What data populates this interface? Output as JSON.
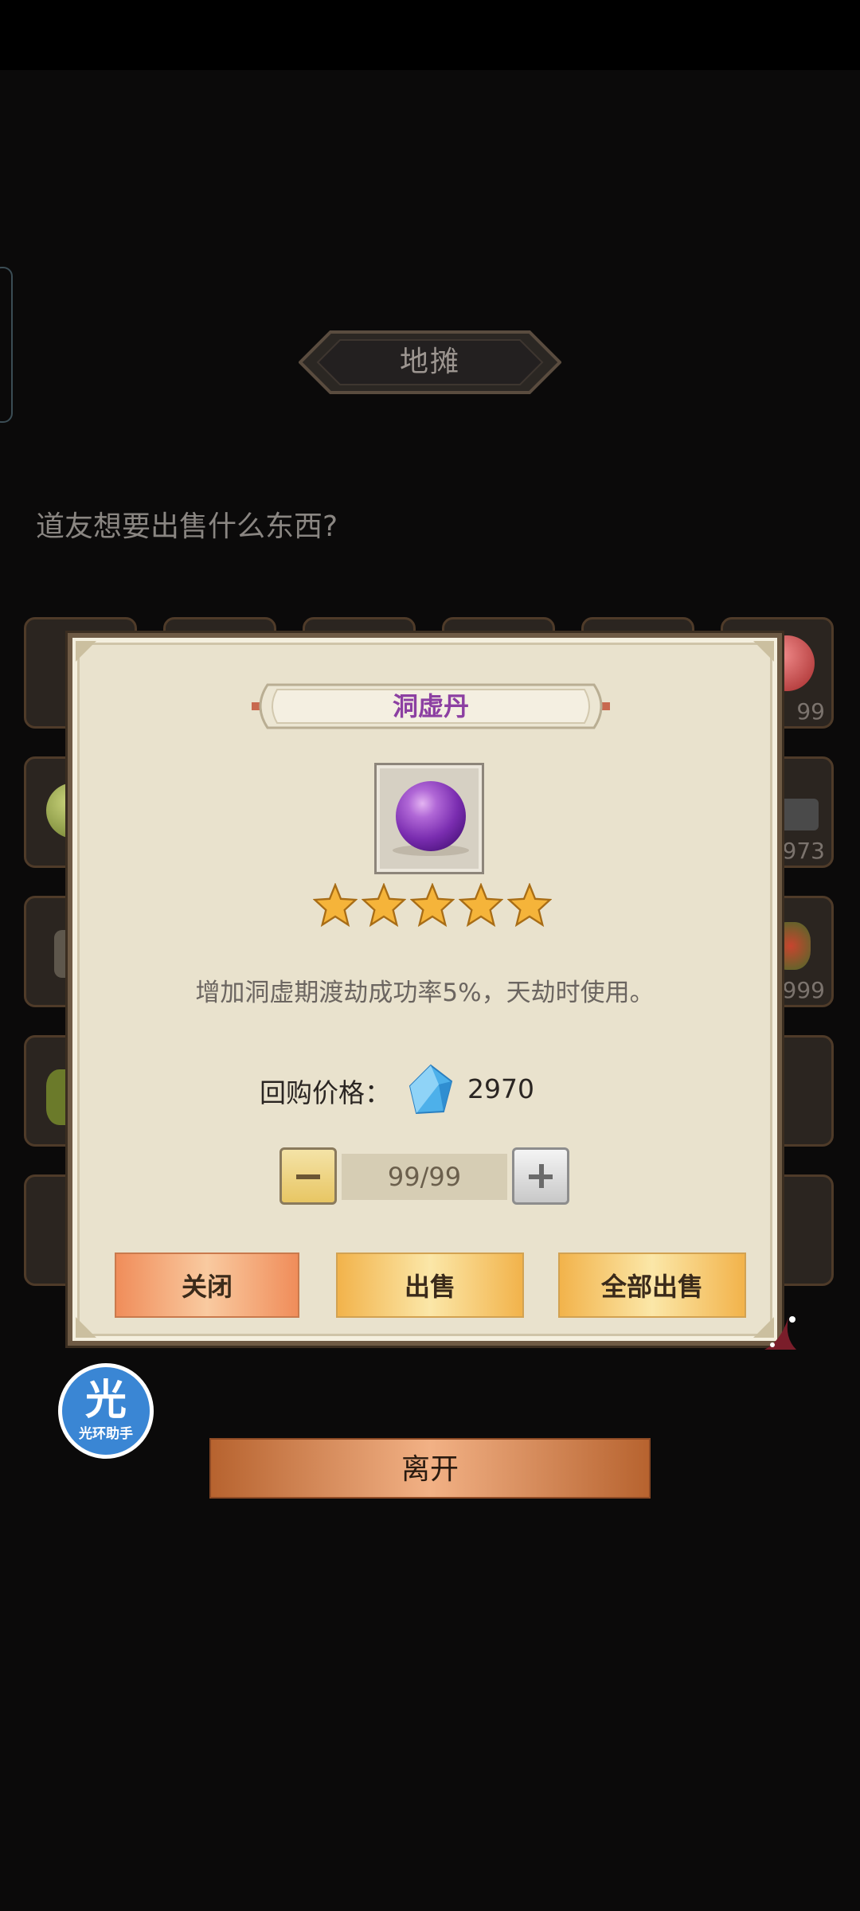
{
  "header": {
    "title": "地摊"
  },
  "prompt": "道友想要出售什么东西?",
  "grid_counts": [
    "99",
    "973",
    "999"
  ],
  "dialog": {
    "item_name": "洞虚丹",
    "icon": "purple-pill-orb",
    "stars": 5,
    "description": "增加洞虚期渡劫成功率5%，天劫时使用。",
    "price_label": "回购价格：",
    "price_currency_icon": "blue-crystal-icon",
    "price_value": "2970",
    "quantity": "99/99",
    "buttons": {
      "close": "关闭",
      "sell": "出售",
      "sell_all": "全部出售"
    }
  },
  "floating_logo": {
    "main": "光",
    "sub": "光环助手"
  },
  "leave_button": "离开",
  "colors": {
    "item_name": "#8c3fa2",
    "dialog_bg": "#e9e2cd"
  }
}
